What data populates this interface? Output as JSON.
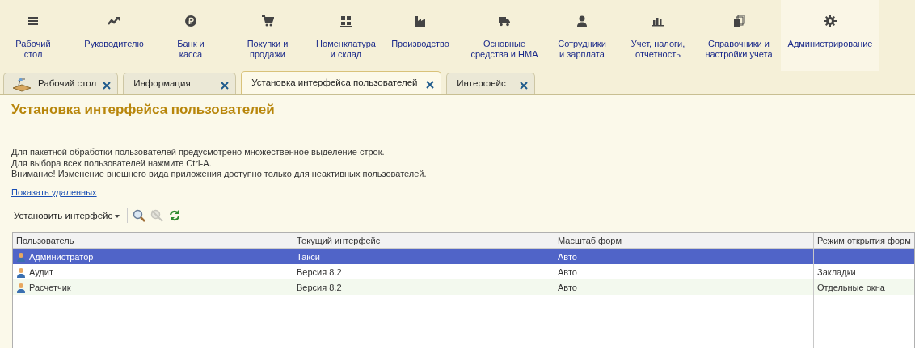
{
  "sections": [
    {
      "label": "Рабочий\nстол",
      "selected": false
    },
    {
      "label": "Руководителю",
      "selected": false
    },
    {
      "label": "Банк и\nкасса",
      "selected": false
    },
    {
      "label": "Покупки и\nпродажи",
      "selected": false
    },
    {
      "label": "Номенклатура\nи склад",
      "selected": false
    },
    {
      "label": "Производство",
      "selected": false
    },
    {
      "label": "Основные\nсредства и НМА",
      "selected": false
    },
    {
      "label": "Сотрудники\nи зарплата",
      "selected": false
    },
    {
      "label": "Учет, налоги,\nотчетность",
      "selected": false
    },
    {
      "label": "Справочники и\nнастройки учета",
      "selected": false
    },
    {
      "label": "Администрирование",
      "selected": true
    }
  ],
  "tabs": [
    {
      "label": "Рабочий стол",
      "selected": false
    },
    {
      "label": "Информация",
      "selected": false
    },
    {
      "label": "Установка интерфейса пользователей",
      "selected": true
    },
    {
      "label": "Интерфейс",
      "selected": false
    }
  ],
  "title": "Установка интерфейса пользователей",
  "notes": [
    "Для пакетной обработки пользователей предусмотрено множественное выделение строк.",
    "Для выбора всех пользователей нажмите Ctrl-A.",
    "Внимание! Изменение внешнего вида приложения доступно только для неактивных пользователей."
  ],
  "link": "Показать удаленных",
  "toolbar": {
    "menu_button": "Установить интерфейс",
    "tools": [
      {
        "kind": "find",
        "disabled": false
      },
      {
        "kind": "cancel-find",
        "disabled": true
      },
      {
        "kind": "refresh",
        "disabled": false
      }
    ]
  },
  "table": {
    "columns": [
      "Пользователь",
      "Текущий интерфейс",
      "Масштаб форм",
      "Режим открытия форм"
    ],
    "rows": [
      {
        "cells": [
          "Администратор",
          "Такси",
          "Авто",
          ""
        ],
        "selected": true
      },
      {
        "cells": [
          "Аудит",
          "Версия 8.2",
          "Авто",
          "Закладки"
        ],
        "selected": false
      },
      {
        "cells": [
          "Расчетчик",
          "Версия 8.2",
          "Авто",
          "Отдельные окна"
        ],
        "selected": false
      }
    ]
  }
}
